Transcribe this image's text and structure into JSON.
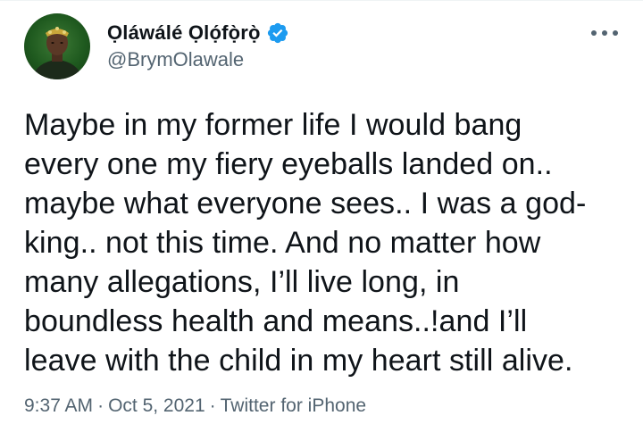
{
  "author": {
    "display_name": "Ọláwálé Ọlọ́fọ̀rọ̀",
    "handle": "@BrymOlawale",
    "verified": true,
    "verified_color": "#1d9bf0"
  },
  "tweet": {
    "text": "Maybe in my former life I would bang\nevery one my fiery eyeballs landed on..\nmaybe what everyone sees.. I was a god-\nking.. not this time. And no matter how\nmany allegations, I’ll live long, in\nboundless health and means..!and I’ll\nleave with the child in my heart still alive."
  },
  "meta": {
    "time": "9:37 AM",
    "separator": "·",
    "date": "Oct 5, 2021",
    "source": "Twitter for iPhone"
  },
  "icons": {
    "more": "more-options-icon",
    "verified": "verified-badge-icon"
  }
}
